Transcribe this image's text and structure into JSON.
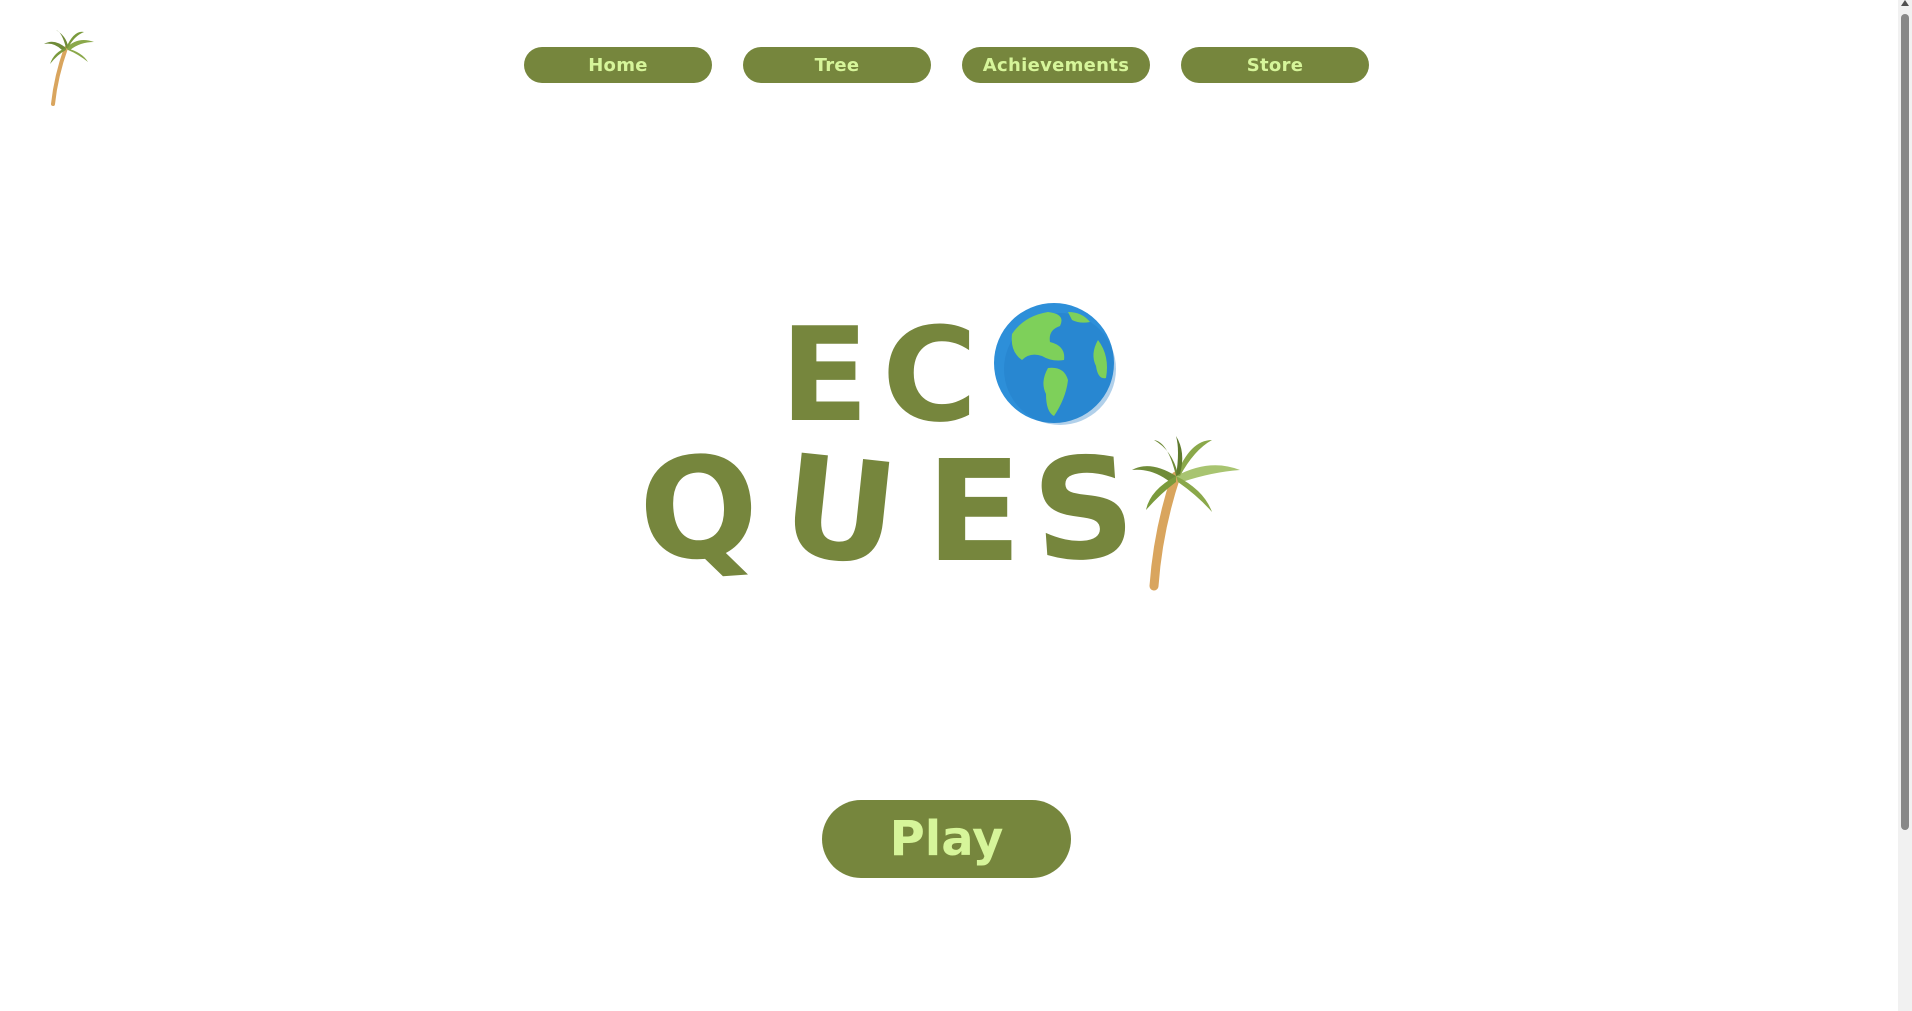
{
  "nav": {
    "items": [
      {
        "label": "Home"
      },
      {
        "label": "Tree"
      },
      {
        "label": "Achievements"
      },
      {
        "label": "Store"
      }
    ]
  },
  "title": {
    "line1": [
      "E",
      "C"
    ],
    "line2": [
      "Q",
      "U",
      "E",
      "S"
    ],
    "globe_icon": "globe-americas-icon",
    "palm_icon": "palm-tree-icon"
  },
  "play": {
    "label": "Play"
  },
  "colors": {
    "brand_green": "#76863d",
    "button_text": "#d6f59a",
    "leaf_green": "#7a9a3c",
    "trunk_tan": "#d9a55e",
    "ocean_blue": "#2d8fd9",
    "land_green": "#7ed05a"
  }
}
